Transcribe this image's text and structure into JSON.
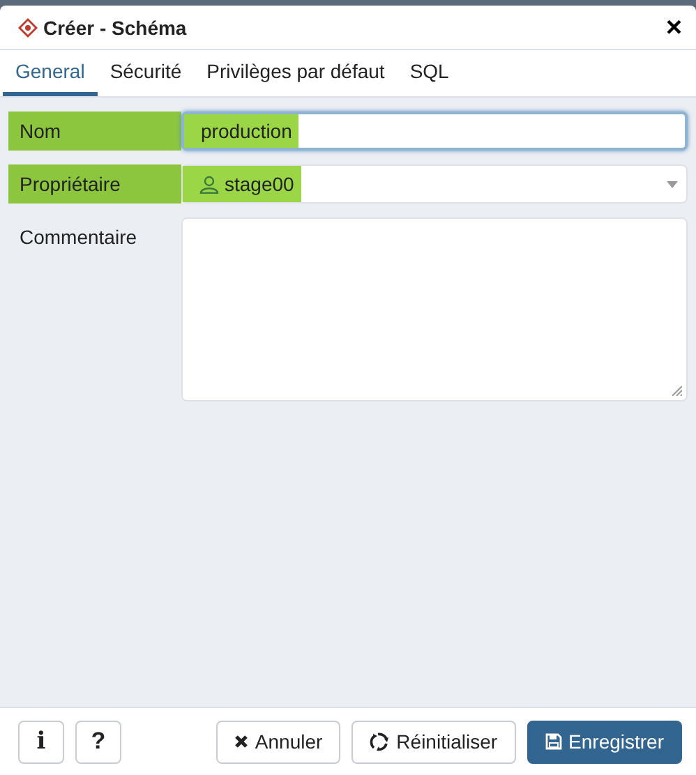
{
  "window": {
    "title": "Créer - Schéma",
    "close": "×"
  },
  "tabs": [
    {
      "label": "General",
      "selected": true
    },
    {
      "label": "Sécurité",
      "selected": false
    },
    {
      "label": "Privilèges par défaut",
      "selected": false
    },
    {
      "label": "SQL",
      "selected": false
    }
  ],
  "fields": [
    {
      "kind": "text",
      "label": "Nom",
      "value": "production",
      "highlighted": true,
      "focused": true
    },
    {
      "kind": "select",
      "label": "Propriétaire",
      "value": "stage00",
      "highlighted": true,
      "focused": false
    },
    {
      "kind": "textarea",
      "label": "Commentaire",
      "highlighted": false,
      "focused": false
    }
  ],
  "footer": {
    "info": "i",
    "help": "?",
    "buttons": [
      {
        "kind": "cancel",
        "label": "Annuler"
      },
      {
        "kind": "reset",
        "label": "Réinitialiser"
      },
      {
        "kind": "save",
        "label": "Enregistrer"
      }
    ]
  }
}
